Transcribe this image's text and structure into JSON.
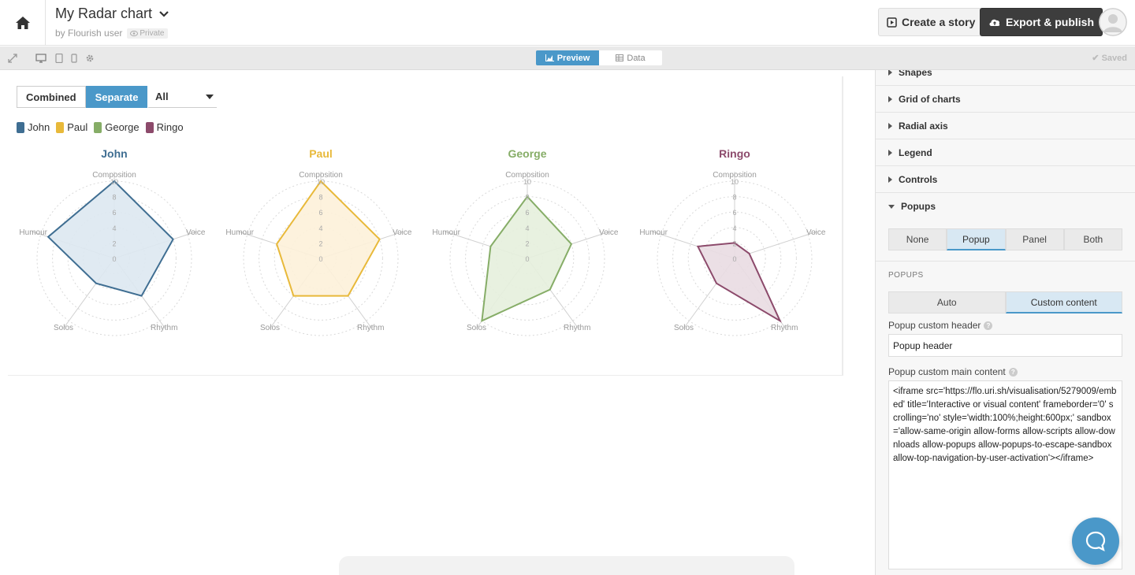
{
  "header": {
    "title": "My Radar chart",
    "byline": "by Flourish user",
    "privacy": "Private",
    "create_story": "Create a story",
    "export_publish": "Export & publish"
  },
  "toolbar": {
    "preview": "Preview",
    "data": "Data",
    "saved": "Saved"
  },
  "controls": {
    "combined": "Combined",
    "separate": "Separate",
    "filter_value": "All"
  },
  "legend": [
    {
      "name": "John",
      "color": "#3f6e92"
    },
    {
      "name": "Paul",
      "color": "#e8b93a"
    },
    {
      "name": "George",
      "color": "#86ad67"
    },
    {
      "name": "Ringo",
      "color": "#8c4a6b"
    }
  ],
  "chart_data": {
    "type": "radar",
    "axes": [
      "Composition",
      "Voice",
      "Rhythm",
      "Solos",
      "Humour"
    ],
    "ticks": [
      0,
      2,
      4,
      6,
      8,
      10
    ],
    "rlim": [
      0,
      10
    ],
    "series": [
      {
        "name": "John",
        "color": "#3f6e92",
        "fill": "#dde8f1",
        "values": [
          10,
          8,
          6,
          4,
          9
        ]
      },
      {
        "name": "Paul",
        "color": "#e8b93a",
        "fill": "#fdf1d9",
        "values": [
          10,
          8,
          6,
          6,
          6
        ]
      },
      {
        "name": "George",
        "color": "#86ad67",
        "fill": "#e5f0dd",
        "values": [
          8,
          6,
          5,
          10,
          5
        ]
      },
      {
        "name": "Ringo",
        "color": "#8c4a6b",
        "fill": "#e9dce2",
        "values": [
          2,
          2,
          10,
          4,
          5
        ]
      }
    ]
  },
  "panel": {
    "sections": [
      "Shapes",
      "Grid of charts",
      "Radial axis",
      "Legend",
      "Controls"
    ],
    "popups_section": "Popups",
    "popup_modes": [
      "None",
      "Popup",
      "Panel",
      "Both"
    ],
    "popup_mode_selected": "Popup",
    "popups_sublabel": "POPUPS",
    "content_modes": [
      "Auto",
      "Custom content"
    ],
    "content_mode_selected": "Custom content",
    "header_label": "Popup custom header",
    "header_value": "Popup header",
    "main_label": "Popup custom main content",
    "main_value": "<iframe src='https://flo.uri.sh/visualisation/5279009/embed' title='Interactive or visual content' frameborder='0' scrolling='no' style='width:100%;height:600px;' sandbox='allow-same-origin allow-forms allow-scripts allow-downloads allow-popups allow-popups-to-escape-sandbox allow-top-navigation-by-user-activation'></iframe>"
  }
}
